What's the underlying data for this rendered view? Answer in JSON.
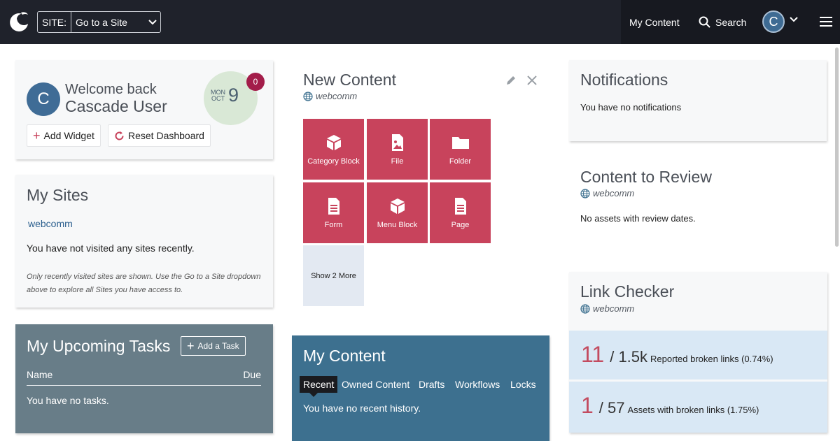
{
  "header": {
    "site_prefix": "SITE:",
    "site_value": "Go to a Site",
    "my_content": "My Content",
    "search": "Search",
    "avatar_initial": "C"
  },
  "welcome": {
    "avatar_initial": "C",
    "greeting": "Welcome back",
    "name": "Cascade User",
    "month": "MON",
    "month2": "OCT",
    "day": "9",
    "badge_count": "0",
    "add_widget": "Add Widget",
    "reset_dashboard": "Reset Dashboard"
  },
  "my_sites": {
    "title": "My Sites",
    "link": "webcomm",
    "message": "You have not visited any sites recently.",
    "note": "Only recently visited sites are shown. Use the Go to a Site dropdown above to explore all Sites you have access to."
  },
  "tasks": {
    "title": "My Upcoming Tasks",
    "add_task": "Add a Task",
    "col_name": "Name",
    "col_due": "Due",
    "empty": "You have no tasks."
  },
  "new_content": {
    "title": "New Content",
    "site": "webcomm",
    "tiles": [
      {
        "label": "Category Block",
        "icon": "cube-icon"
      },
      {
        "label": "File",
        "icon": "file-image-icon"
      },
      {
        "label": "Folder",
        "icon": "folder-icon"
      },
      {
        "label": "Form",
        "icon": "document-icon"
      },
      {
        "label": "Menu Block",
        "icon": "cube-icon"
      },
      {
        "label": "Page",
        "icon": "document-icon"
      }
    ],
    "show_more": "Show 2 More"
  },
  "my_content": {
    "title": "My Content",
    "tabs": [
      "Recent",
      "Owned Content",
      "Drafts",
      "Workflows",
      "Locks"
    ],
    "empty": "You have no recent history."
  },
  "notifications": {
    "title": "Notifications",
    "empty": "You have no notifications"
  },
  "review": {
    "title": "Content to Review",
    "site": "webcomm",
    "empty": "No assets with review dates."
  },
  "link_checker": {
    "title": "Link Checker",
    "site": "webcomm",
    "row1": {
      "big": "11",
      "total": "/ 1.5k",
      "label": "Reported broken links (0.74%)"
    },
    "row2": {
      "big": "1",
      "total": "/ 57",
      "label": "Assets with broken links (1.75%)"
    }
  },
  "colors": {
    "topbar": "#1f222b",
    "tile": "#c8435c",
    "tasks_bg": "#687d88",
    "mycontent_bg": "#3d708f",
    "badge": "#a31d4a"
  }
}
